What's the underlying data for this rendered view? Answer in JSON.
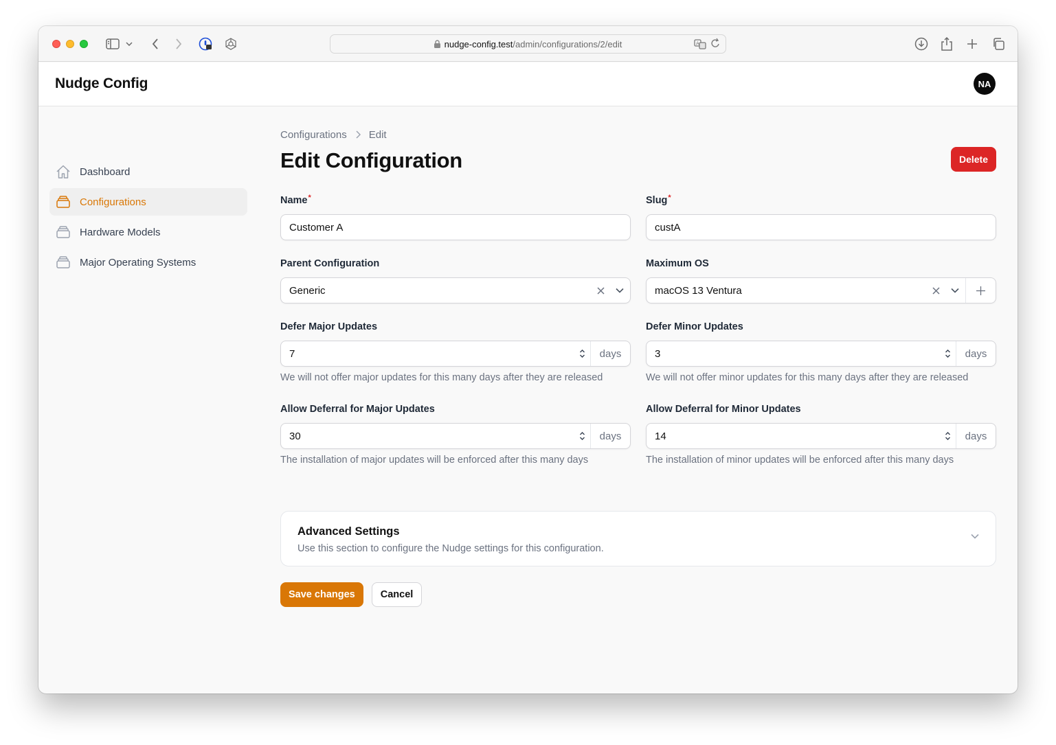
{
  "browser": {
    "url_domain": "nudge-config.test",
    "url_path": "/admin/configurations/2/edit"
  },
  "app": {
    "brand": "Nudge Config",
    "avatar_initials": "NA"
  },
  "sidebar": {
    "items": [
      {
        "label": "Dashboard",
        "icon": "home-icon"
      },
      {
        "label": "Configurations",
        "icon": "stack-icon",
        "active": true
      },
      {
        "label": "Hardware Models",
        "icon": "stack-icon"
      },
      {
        "label": "Major Operating Systems",
        "icon": "stack-icon"
      }
    ]
  },
  "breadcrumb": {
    "root": "Configurations",
    "current": "Edit"
  },
  "page": {
    "title": "Edit Configuration",
    "delete_label": "Delete"
  },
  "form": {
    "name": {
      "label": "Name",
      "required": "*",
      "value": "Customer A"
    },
    "slug": {
      "label": "Slug",
      "required": "*",
      "value": "custA"
    },
    "parent": {
      "label": "Parent Configuration",
      "value": "Generic"
    },
    "max_os": {
      "label": "Maximum OS",
      "value": "macOS 13 Ventura"
    },
    "defer_major": {
      "label": "Defer Major Updates",
      "value": "7",
      "suffix": "days",
      "hint": "We will not offer major updates for this many days after they are released"
    },
    "defer_minor": {
      "label": "Defer Minor Updates",
      "value": "3",
      "suffix": "days",
      "hint": "We will not offer minor updates for this many days after they are released"
    },
    "allow_major": {
      "label": "Allow Deferral for Major Updates",
      "value": "30",
      "suffix": "days",
      "hint": "The installation of major updates will be enforced after this many days"
    },
    "allow_minor": {
      "label": "Allow Deferral for Minor Updates",
      "value": "14",
      "suffix": "days",
      "hint": "The installation of minor updates will be enforced after this many days"
    }
  },
  "advanced": {
    "title": "Advanced Settings",
    "description": "Use this section to configure the Nudge settings for this configuration."
  },
  "actions": {
    "save_label": "Save changes",
    "cancel_label": "Cancel"
  },
  "colors": {
    "accent": "#d97706",
    "danger": "#dc2626"
  }
}
